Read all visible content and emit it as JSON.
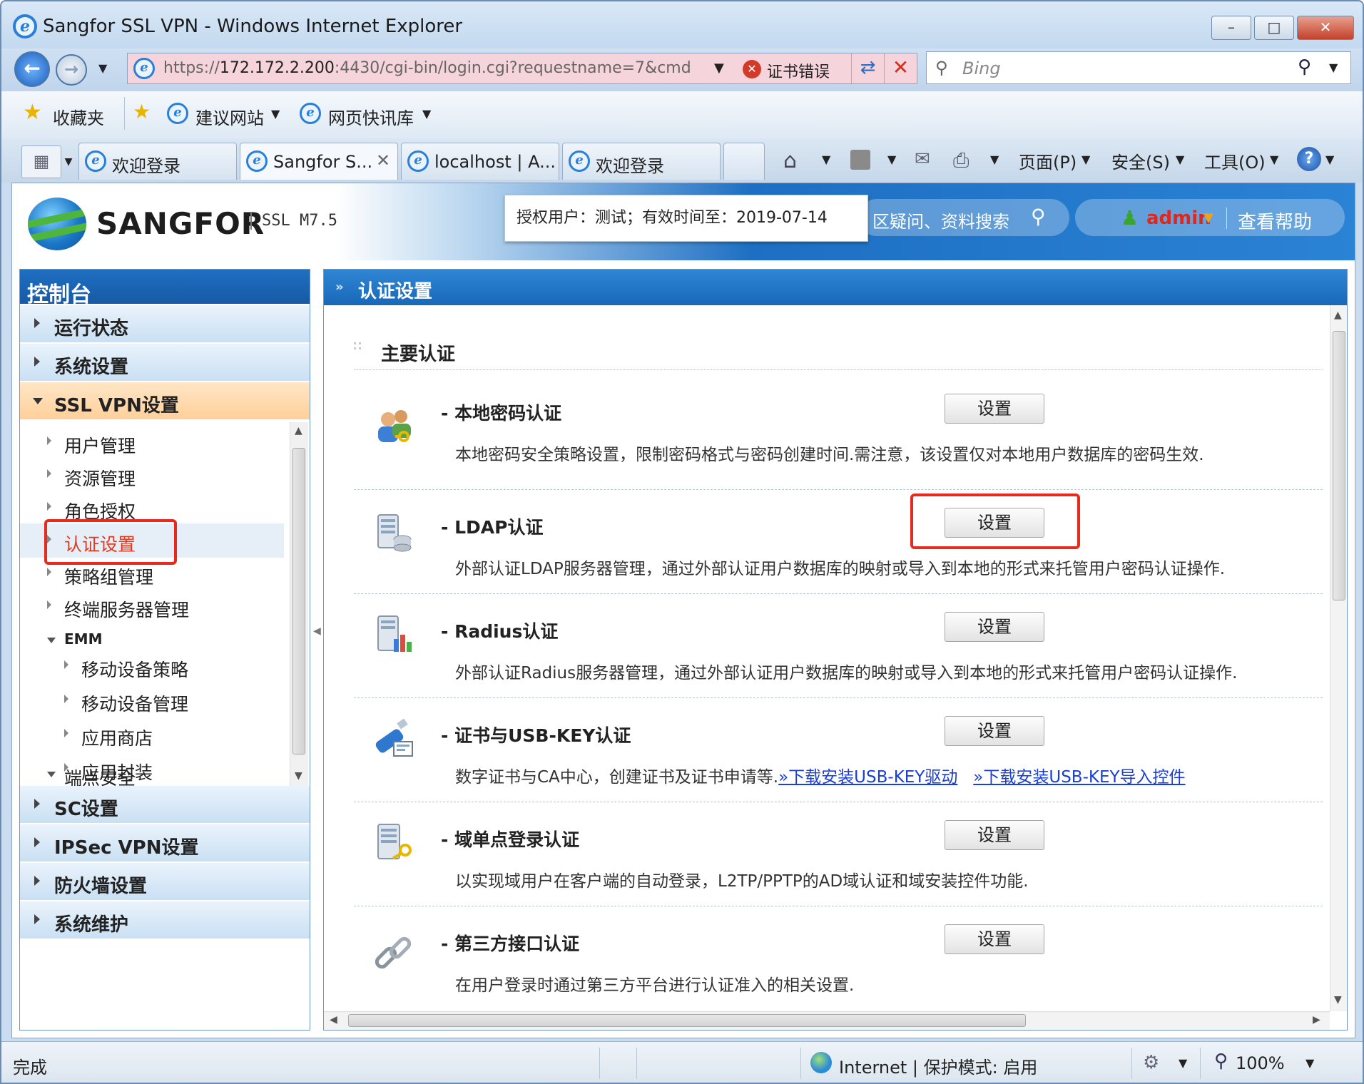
{
  "window": {
    "title": "Sangfor SSL VPN - Windows Internet Explorer",
    "minimize": "–",
    "restore": "□",
    "close": "✕"
  },
  "address_bar": {
    "url_secure_part": "https://",
    "url_host": "172.172.2.200",
    "url_rest": ":4430/cgi-bin/login.cgi?requestname=7&cmd",
    "cert_error": "证书错误",
    "search_placeholder": "Bing"
  },
  "favorites_bar": {
    "favorites": "收藏夹",
    "suggested_sites": "建议网站",
    "web_slice_gallery": "网页快讯库"
  },
  "tabs": [
    {
      "label": "欢迎登录"
    },
    {
      "label": "Sangfor S..."
    },
    {
      "label": "localhost | A..."
    },
    {
      "label": "欢迎登录"
    }
  ],
  "command_bar": {
    "page": "页面(P)",
    "safety": "安全(S)",
    "tools": "工具(O)"
  },
  "app_header": {
    "brand": "SANGFOR",
    "version": "SSL M7.5",
    "license_notice": "授权用户：测试；有效时间至：2019-07-14",
    "search_text": "区疑问、资料搜索",
    "user": "admin",
    "help": "查看帮助"
  },
  "sidebar": {
    "title": "控制台",
    "top_items": [
      {
        "label": "运行状态"
      },
      {
        "label": "系统设置"
      },
      {
        "label": "SSL VPN设置"
      }
    ],
    "sub_items": [
      {
        "label": "用户管理"
      },
      {
        "label": "资源管理"
      },
      {
        "label": "角色授权"
      },
      {
        "label": "认证设置"
      },
      {
        "label": "策略组管理"
      },
      {
        "label": "终端服务器管理"
      },
      {
        "label": "EMM"
      },
      {
        "label": "移动设备策略"
      },
      {
        "label": "移动设备管理"
      },
      {
        "label": "应用商店"
      },
      {
        "label": "应用封装"
      },
      {
        "label": "端点安全"
      }
    ],
    "bottom_items": [
      {
        "label": "SC设置"
      },
      {
        "label": "IPSec VPN设置"
      },
      {
        "label": "防火墙设置"
      },
      {
        "label": "系统维护"
      }
    ]
  },
  "main": {
    "header": "认证设置",
    "section_title": "主要认证",
    "button_label": "设置",
    "rows": [
      {
        "title": "本地密码认证",
        "desc": "本地密码安全策略设置，限制密码格式与密码创建时间.需注意，该设置仅对本地用户数据库的密码生效."
      },
      {
        "title": "LDAP认证",
        "desc": "外部认证LDAP服务器管理，通过外部认证用户数据库的映射或导入到本地的形式来托管用户密码认证操作."
      },
      {
        "title": "Radius认证",
        "desc": "外部认证Radius服务器管理，通过外部认证用户数据库的映射或导入到本地的形式来托管用户密码认证操作."
      },
      {
        "title": "证书与USB-KEY认证",
        "desc": "数字证书与CA中心，创建证书及证书申请等.",
        "link1": "»下载安装USB-KEY驱动",
        "link2": "»下载安装USB-KEY导入控件"
      },
      {
        "title": "域单点登录认证",
        "desc": "以实现域用户在客户端的自动登录，L2TP/PPTP的AD域认证和域安装控件功能."
      },
      {
        "title": "第三方接口认证",
        "desc": "在用户登录时通过第三方平台进行认证准入的相关设置."
      }
    ]
  },
  "status_bar": {
    "status": "完成",
    "zone": "Internet | 保护模式: 启用",
    "zoom": "100%"
  }
}
